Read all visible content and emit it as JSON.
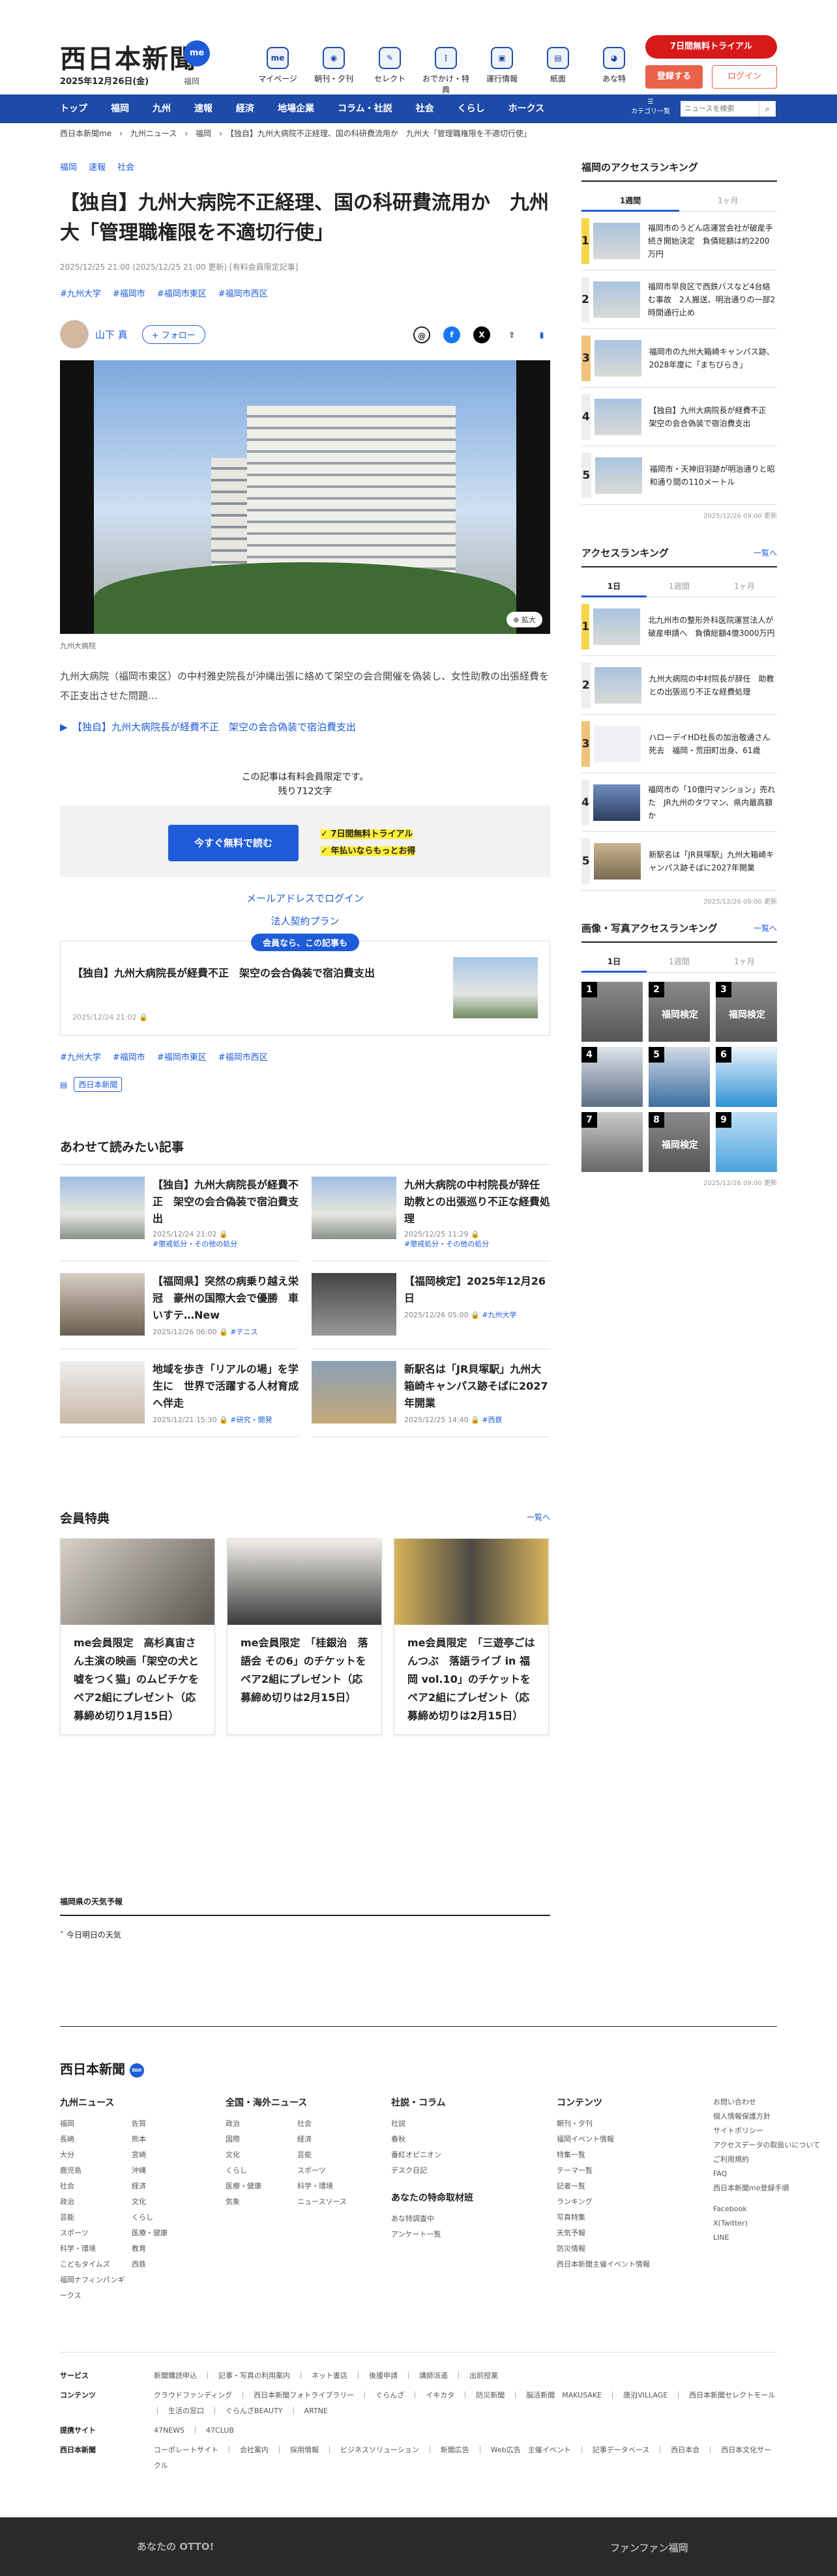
{
  "header": {
    "logo": "西日本新聞",
    "logo_badge": "me",
    "date": "2025年12月26日(金)",
    "location": "福岡",
    "nav_icons": [
      {
        "label": "マイページ",
        "icon": "me"
      },
      {
        "label": "朝刊・夕刊",
        "icon": "paper"
      },
      {
        "label": "セレクト",
        "icon": "select"
      },
      {
        "label": "おでかけ・特典",
        "icon": "footprint"
      },
      {
        "label": "運行情報",
        "icon": "bus"
      },
      {
        "label": "紙面",
        "icon": "newspaper"
      },
      {
        "label": "あな特",
        "icon": "owl"
      }
    ],
    "trial": "7日間無料トライアル",
    "register": "登録する",
    "login": "ログイン"
  },
  "navbar": {
    "items": [
      "トップ",
      "福岡",
      "九州",
      "速報",
      "経済",
      "地場企業",
      "コラム・社説",
      "社会",
      "くらし",
      "ホークス"
    ],
    "category": "カテゴリ一覧",
    "search_placeholder": "ニュースを検索",
    "search_icon": "search-icon"
  },
  "breadcrumb": "西日本新聞me　›　九州ニュース　›　福岡　›　【独自】九州大病院不正経理、国の科研費流用か　九州大「管理職権限を不適切行使」",
  "article": {
    "top_tags": [
      "福岡",
      "速報",
      "社会"
    ],
    "title": "【独自】九州大病院不正経理、国の科研費流用か　九州大「管理職権限を不適切行使」",
    "meta": "2025/12/25 21:00 (2025/12/25 21:00 更新) [有料会員限定記事]",
    "tags": [
      "#九州大学",
      "#福岡市",
      "#福岡市東区",
      "#福岡市西区"
    ],
    "author": "山下 真",
    "follow": "+ フォロー",
    "photo_zoom": "拡大",
    "caption": "九州大病院",
    "lead": "九州大病院（福岡市東区）の中村雅史院長が沖縄出張に絡めて架空の会合開催を偽装し、女性助教の出張経費を不正支出させた問題…",
    "related": "▶　【独自】九州大病院長が経費不正　架空の会合偽装で宿泊費支出",
    "paywall_note1": "この記事は有料会員限定です。",
    "paywall_note2": "残り712文字",
    "paywall_btn": "今すぐ無料で読む",
    "paywall_p1": "✓ 7日間無料トライアル",
    "paywall_p2": "✓ 年払いならもっとお得",
    "email_login": "メールアドレスでログイン",
    "corporate": "法人契約プラン",
    "member_tag": "会員なら、この記事も",
    "member_title": "【独自】九州大病院長が経費不正　架空の会合偽装で宿泊費支出",
    "member_date": "2025/12/24 21:02 🔒",
    "source": "西日本新聞"
  },
  "recommend": {
    "title": "あわせて読みたい記事",
    "items": [
      {
        "title": "【独自】九州大病院長が経費不正　架空の会合偽装で宿泊費支出",
        "date": "2025/12/24 21:02 🔒",
        "tag": "#懲戒処分・その他の処分"
      },
      {
        "title": "九州大病院の中村院長が辞任　助教との出張巡り不正な経費処理",
        "date": "2025/12/25 11:29 🔒",
        "tag": "#懲戒処分・その他の処分"
      },
      {
        "title": "【福岡県】突然の病乗り越え栄冠　豪州の国際大会で優勝　車いすテ…New",
        "date": "2025/12/26 06:00 🔒",
        "tag": "#テニス"
      },
      {
        "title": "【福岡検定】2025年12月26日",
        "date": "2025/12/26 05:00 🔒",
        "tag": "#九州大学"
      },
      {
        "title": "地域を歩き「リアルの場」を学生に　世界で活躍する人材育成へ伴走",
        "date": "2025/12/21 15:30 🔒",
        "tag": "#研究・開発"
      },
      {
        "title": "新駅名は「JR貝塚駅」九州大箱崎キャンパス跡そばに2027年開業",
        "date": "2025/12/25 14:40 🔒",
        "tag": "#西鉄"
      }
    ]
  },
  "perks": {
    "title": "会員特典",
    "more": "一覧へ",
    "items": [
      "me会員限定　高杉真宙さん主演の映画「架空の犬と嘘をつく猫」のムビチケをペア2組にプレゼント（応募締め切り1月15日）",
      "me会員限定　「桂銀治　落語会 その6」のチケットをペア2組にプレゼント（応募締め切りは2月15日）",
      "me会員限定　「三遊亭ごはんつぶ　落語ライブ in 福岡 vol.10」のチケットをペア2組にプレゼント（応募締め切りは2月15日）"
    ]
  },
  "weather": {
    "title": "福岡県の天気予報",
    "item": "今日明日の天気"
  },
  "sidebar": {
    "ranking_title": "福岡のアクセスランキング",
    "ranking_tabs": [
      "1週間",
      "1ヶ月"
    ],
    "ranking": [
      "福岡市のうどん店運営会社が破産手続き開始決定　負債総額は約2200万円",
      "福岡市早良区で西鉄バスなど4台絡む事故　2人搬送、明治通りの一部2時間通行止め",
      "福岡市の九州大箱崎キャンパス跡、2028年度に「まちびらき」",
      "【独自】九州大病院長が経費不正　架空の会合偽装で宿泊費支出",
      "福岡市・天神旧羽跡が明治通りと昭和通り間の110メートル"
    ],
    "ranking_updated": "2025/12/26 09:00 更新",
    "access_title": "アクセスランキング",
    "access_more": "一覧へ",
    "access_tabs": [
      "1日",
      "1週間",
      "1ヶ月"
    ],
    "access": [
      "北九州市の整形外科医院運営法人が破産申請へ　負債総額4億3000万円",
      "九州大病院の中村院長が辞任　助教との出張巡り不正な経費処理",
      "ハローデイHD社長の加治敬通さん死去　福岡・荒田町出身、61歳",
      "福岡市の「10億円マンション」売れた　JR九州のタワマン、県内最高額か",
      "新駅名は「JR貝塚駅」九州大箱崎キャンパス跡そばに2027年開業"
    ],
    "access_updated": "2025/12/26 09:00 更新",
    "photo_title": "画像・写真アクセスランキング",
    "photo_more": "一覧へ",
    "photo_tabs": [
      "1日",
      "1週間",
      "1ヶ月"
    ],
    "photo_labels": [
      "",
      "福岡検定",
      "福岡検定",
      "",
      "",
      "",
      "",
      "福岡検定",
      ""
    ],
    "photo_updated": "2025/12/26 09:00 更新"
  },
  "footer": {
    "logo": "西日本新聞",
    "cols": [
      {
        "title": "九州ニュース",
        "items": [
          "福岡",
          "佐賀",
          "長崎",
          "熊本",
          "大分",
          "宮崎",
          "鹿児島",
          "沖縄",
          "社会",
          "経済",
          "政治",
          "文化",
          "芸能",
          "くらし",
          "スポーツ",
          "医療・健康",
          "科学・環境",
          "教育",
          "こどもタイムズ",
          "西鉄",
          "福岡ナフィンパンギークス"
        ]
      },
      {
        "title": "全国・海外ニュース",
        "items": [
          "政治",
          "社会",
          "国際",
          "経済",
          "文化",
          "芸能",
          "くらし",
          "スポーツ",
          "医療・健康",
          "科学・環境",
          "気象",
          "ニュースソース"
        ]
      },
      {
        "title": "社説・コラム",
        "items": [
          "社説",
          "春秋",
          "番紅オピニオン",
          "デスク日記"
        ],
        "title2": "あなたの特命取材班",
        "items2": [
          "あな特調査中",
          "アンケート一覧"
        ]
      },
      {
        "title": "コンテンツ",
        "items": [
          "朝刊・夕刊",
          "福岡イベント情報",
          "特集一覧",
          "テーマ一覧",
          "記者一覧",
          "ランキング",
          "写真特集",
          "天気予報",
          "防災情報",
          "西日本新聞主催イベント情報"
        ]
      }
    ],
    "side": [
      "お問い合わせ",
      "個人情報保護方針",
      "サイトポリシー",
      "アクセスデータの取扱いについて",
      "ご利用規約",
      "FAQ",
      "西日本新聞me登録手順",
      "Facebook",
      "X(Twitter)",
      "LINE"
    ],
    "rows": [
      {
        "label": "サービス",
        "text": "新聞購読申込　｜　記事・写真の利用案内　｜　ネット書店　｜　後援申請　｜　講師派遣　｜　出前授業"
      },
      {
        "label": "コンテンツ",
        "text": "クラウドファンディング　｜　西日本新聞フォトライブラリー　｜　ぐらんざ　｜　イキカタ　｜　防災新聞　｜　脳活新聞　MAKUSAKE　｜　唐泊VILLAGE　｜　西日本新聞セレクトモール　｜　生活の窓口　｜　ぐらんざBEAUTY　｜　ARTNE"
      },
      {
        "label": "提携サイト",
        "text": "47NEWS　｜　47CLUB"
      },
      {
        "label": "西日本新聞",
        "text": "コーポレートサイト　｜　会社案内　｜　採用情報　｜　ビジネスソリューション　｜　新聞広告　｜　Web広告　主催イベント　｜　記事データベース　｜　西日本会　｜　西日本文化サークル"
      }
    ],
    "band_left": "あなたの OTTO!",
    "band_right": "ファンファン福岡"
  }
}
